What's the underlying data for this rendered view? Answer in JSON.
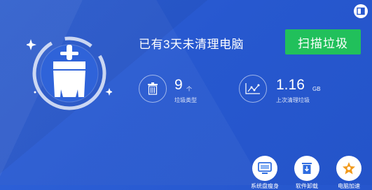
{
  "header": {
    "headline": "已有3天未清理电脑",
    "scan_button": "扫描垃圾"
  },
  "stats": {
    "junk_types": {
      "value": "9",
      "unit": "个",
      "label": "垃圾类型",
      "icon": "trash-icon"
    },
    "last_clean": {
      "value": "1.16",
      "unit": "GB",
      "label": "上次清理垃圾",
      "icon": "trend-chart-icon"
    }
  },
  "toolbar": [
    {
      "name": "tool-monitor",
      "icon": "monitor-icon",
      "label": "系统盘瘦身"
    },
    {
      "name": "tool-uninstall",
      "icon": "trash-download-icon",
      "label": "软件卸载"
    },
    {
      "name": "tool-optimize",
      "icon": "puzzle-icon",
      "label": "电脑加速"
    }
  ],
  "colors": {
    "background": "#2758cf",
    "scan_button": "#21c05b",
    "tool_icon_blue": "#2f6de0",
    "tool_icon_orange": "#f29a1c"
  }
}
